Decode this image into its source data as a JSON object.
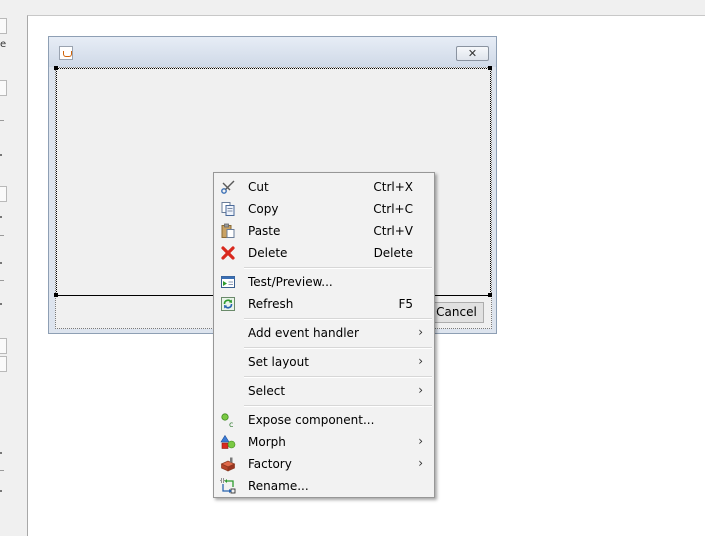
{
  "dialog": {
    "close_glyph": "✕",
    "cancel_label": "Cancel"
  },
  "left_strip": {
    "glyphs": [
      "e"
    ]
  },
  "menu": {
    "cut": {
      "label": "Cut",
      "shortcut": "Ctrl+X",
      "icon": "scissors-icon"
    },
    "copy": {
      "label": "Copy",
      "shortcut": "Ctrl+C",
      "icon": "copy-icon"
    },
    "paste": {
      "label": "Paste",
      "shortcut": "Ctrl+V",
      "icon": "paste-icon"
    },
    "delete": {
      "label": "Delete",
      "shortcut": "Delete",
      "icon": "red-x-icon"
    },
    "test_preview": {
      "label": "Test/Preview...",
      "icon": "preview-window-icon"
    },
    "refresh": {
      "label": "Refresh",
      "shortcut": "F5",
      "icon": "refresh-icon"
    },
    "add_event_handler": {
      "label": "Add event handler",
      "submenu": true
    },
    "set_layout": {
      "label": "Set layout",
      "submenu": true
    },
    "select": {
      "label": "Select",
      "submenu": true
    },
    "expose_component": {
      "label": "Expose component...",
      "icon": "expose-icon"
    },
    "morph": {
      "label": "Morph",
      "submenu": true,
      "icon": "morph-shapes-icon"
    },
    "factory": {
      "label": "Factory",
      "submenu": true,
      "icon": "factory-icon"
    },
    "rename": {
      "label": "Rename...",
      "icon": "rename-icon"
    },
    "submenu_arrow": "›"
  },
  "colors": {
    "menu_bg": "#f2f2f2",
    "delete_red": "#d9291e",
    "refresh_green": "#2e9b2e"
  }
}
